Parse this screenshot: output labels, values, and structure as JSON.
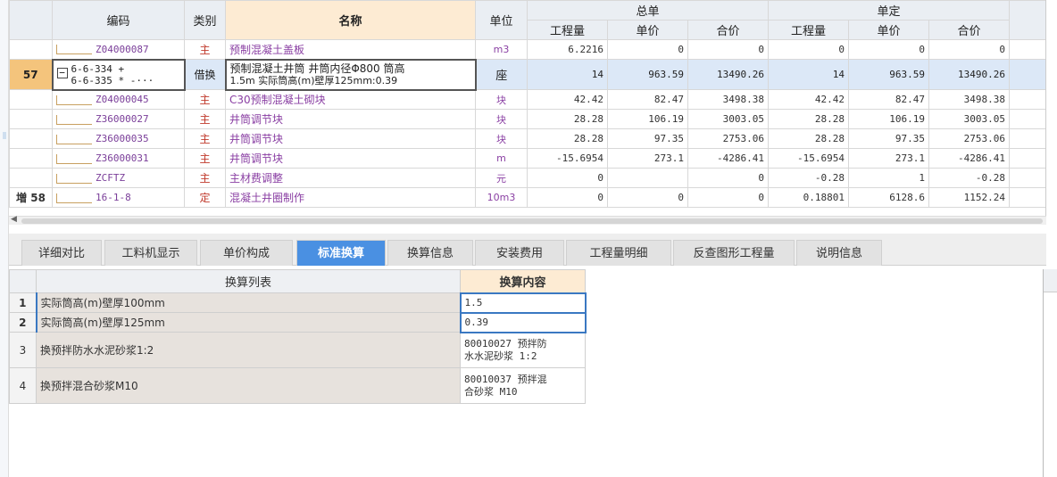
{
  "grid": {
    "headers": {
      "code": "编码",
      "category": "类别",
      "name": "名称",
      "unit": "单位",
      "group1": "总单",
      "group2": "单定",
      "qty": "工程量",
      "price": "单价",
      "total": "合价"
    },
    "rows": [
      {
        "idx": "",
        "code": "Z04000087",
        "cat": "主",
        "name": "预制混凝土盖板",
        "unit": "m3",
        "q1": "6.2216",
        "p1": "0",
        "t1": "0",
        "q2": "0",
        "p2": "0",
        "t2": "0"
      },
      {
        "idx": "57",
        "code_line1": "6-6-334 +",
        "code_line2": "6-6-335 * -···",
        "toggle": "−",
        "cat": "借换",
        "name_line1": "预制混凝土井筒 井筒内径Φ800 筒高",
        "name_line2": "1.5m  实际筒高(m)壁厚125mm:0.39",
        "unit": "座",
        "q1": "14",
        "p1": "963.59",
        "t1": "13490.26",
        "q2": "14",
        "p2": "963.59",
        "t2": "13490.26"
      },
      {
        "idx": "",
        "code": "Z04000045",
        "cat": "主",
        "name": "C30预制混凝土砌块",
        "unit": "块",
        "q1": "42.42",
        "p1": "82.47",
        "t1": "3498.38",
        "q2": "42.42",
        "p2": "82.47",
        "t2": "3498.38"
      },
      {
        "idx": "",
        "code": "Z36000027",
        "cat": "主",
        "name": "井筒调节块",
        "unit": "块",
        "q1": "28.28",
        "p1": "106.19",
        "t1": "3003.05",
        "q2": "28.28",
        "p2": "106.19",
        "t2": "3003.05"
      },
      {
        "idx": "",
        "code": "Z36000035",
        "cat": "主",
        "name": "井筒调节块",
        "unit": "块",
        "q1": "28.28",
        "p1": "97.35",
        "t1": "2753.06",
        "q2": "28.28",
        "p2": "97.35",
        "t2": "2753.06"
      },
      {
        "idx": "",
        "code": "Z36000031",
        "cat": "主",
        "name": "井筒调节块",
        "unit": "m",
        "q1": "-15.6954",
        "p1": "273.1",
        "t1": "-4286.41",
        "q2": "-15.6954",
        "p2": "273.1",
        "t2": "-4286.41"
      },
      {
        "idx": "",
        "code": "ZCFTZ",
        "cat": "主",
        "name": "主材费调整",
        "unit": "元",
        "q1": "0",
        "p1": "",
        "t1": "0",
        "q2": "-0.28",
        "p2": "1",
        "t2": "-0.28"
      },
      {
        "idx": "増 58",
        "code": "16-1-8",
        "cat": "定",
        "name": "混凝土井圈制作",
        "unit": "10m3",
        "q1": "0",
        "p1": "0",
        "t1": "0",
        "q2": "0.18801",
        "p2": "6128.6",
        "t2": "1152.24"
      }
    ]
  },
  "tabs": [
    "详细对比",
    "工料机显示",
    "单价构成",
    "标准换算",
    "换算信息",
    "安装费用",
    "工程量明细",
    "反查图形工程量",
    "说明信息"
  ],
  "active_tab": "标准换算",
  "conversion": {
    "header_list": "换算列表",
    "header_content": "换算内容",
    "rows": [
      {
        "n": "1",
        "label": "实际筒高(m)壁厚100mm",
        "value": "1.5"
      },
      {
        "n": "2",
        "label": "实际筒高(m)壁厚125mm",
        "value": "0.39"
      },
      {
        "n": "3",
        "label": "换预拌防水水泥砂浆1:2",
        "value_line1": "80010027  预拌防",
        "value_line2": "水水泥砂浆 1:2"
      },
      {
        "n": "4",
        "label": "换预拌混合砂浆M10",
        "value_line1": "80010037  预拌混",
        "value_line2": "合砂浆 M10"
      }
    ]
  },
  "colors": {
    "accent": "#4a90e2",
    "header_highlight": "#fdebd3",
    "selected_row": "#dce8f7",
    "code_text": "#7a3e99"
  }
}
